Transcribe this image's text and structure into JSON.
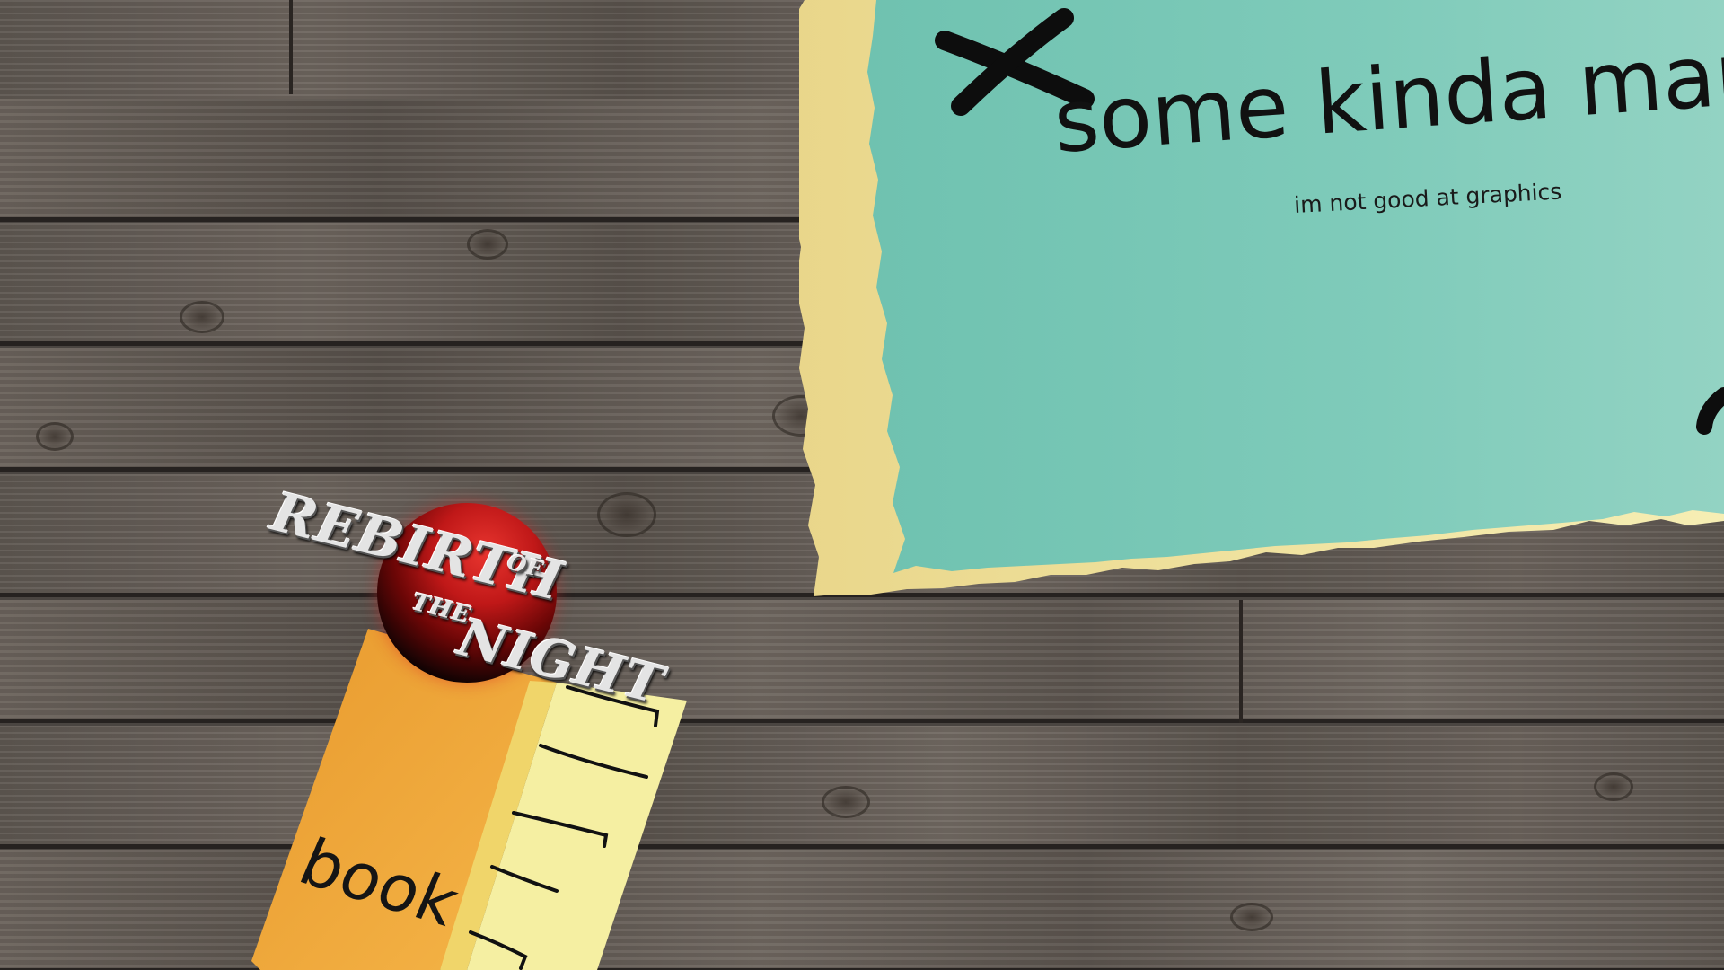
{
  "map": {
    "title": "some kinda map",
    "subtitle": "im not good at graphics",
    "paper_color": "#7ccab8",
    "edge_color": "#f3e9a6"
  },
  "book": {
    "label": "book",
    "cover_color": "#f2ad3c",
    "page_color": "#f7f2a6"
  },
  "logo": {
    "line1": "REBIRTH",
    "of": "OF",
    "the": "THE",
    "night": "NIGHT",
    "orb_color": "#c01818"
  },
  "background": {
    "wood_color": "#625b55"
  }
}
